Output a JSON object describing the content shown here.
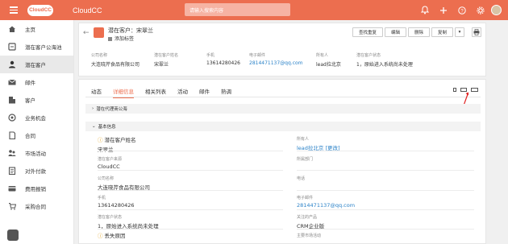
{
  "topbar": {
    "logo": "CloudCC",
    "app_name": "CloudCC",
    "search_placeholder": "请输入搜索内容",
    "icons": [
      "bell-icon",
      "plus-icon",
      "help-icon",
      "gear-icon"
    ]
  },
  "sidebar": {
    "items": [
      {
        "label": "主页",
        "icon": "home-icon"
      },
      {
        "label": "潜在客户公海池",
        "icon": "pool-icon"
      },
      {
        "label": "潜在客户",
        "icon": "person-icon",
        "active": true
      },
      {
        "label": "邮件",
        "icon": "mail-icon"
      },
      {
        "label": "客户",
        "icon": "building-icon"
      },
      {
        "label": "业务机会",
        "icon": "opportunity-icon"
      },
      {
        "label": "合同",
        "icon": "contract-icon"
      },
      {
        "label": "市场活动",
        "icon": "marketing-icon"
      },
      {
        "label": "对外付款",
        "icon": "payment-icon"
      },
      {
        "label": "费用报销",
        "icon": "expense-icon"
      },
      {
        "label": "采购合同",
        "icon": "purchase-icon"
      }
    ]
  },
  "header": {
    "title": "潜在客户：宋翠兰",
    "add_tag": "添加标签",
    "buttons": {
      "find_dup": "查找重复",
      "edit": "编辑",
      "delete": "删除",
      "copy": "复制",
      "more": "▾"
    },
    "fields": [
      {
        "label": "公司名称",
        "value": "大连晓芹食品有限公司",
        "link": false
      },
      {
        "label": "潜在客户姓名",
        "value": "宋翠兰",
        "link": false
      },
      {
        "label": "手机",
        "value": "13614280426",
        "link": false
      },
      {
        "label": "电子邮件",
        "value": "2814471137@qq.com",
        "link": true
      },
      {
        "label": "所有人",
        "value": "lead拉北京",
        "link": false
      },
      {
        "label": "潜在客户状态",
        "value": "1，原始进入系统尚未处理",
        "link": false
      }
    ]
  },
  "detail": {
    "tabs": [
      "动态",
      "详细信息",
      "相关列表",
      "活动",
      "邮件",
      "熟调"
    ],
    "active_tab": "详细信息",
    "section_collapsed": "潜在代理商公海",
    "section_basic": "基本信息",
    "fields_left": [
      {
        "label": "潜在客户姓名",
        "value": "宋翠兰",
        "required": true
      },
      {
        "label": "潜在客户来源",
        "value": "CloudCC",
        "required": false
      },
      {
        "label": "公司名称",
        "value": "大连晓芹食品有限公司",
        "required": false
      },
      {
        "label": "手机",
        "value": "13614280426",
        "required": false
      },
      {
        "label": "潜在客户状态",
        "value": "1，原始进入系统尚未处理",
        "required": false
      },
      {
        "label": "丢失原因",
        "value": "",
        "required": true
      }
    ],
    "fields_right": [
      {
        "label": "所有人",
        "value": "lead拉北京",
        "change": "[更改]"
      },
      {
        "label": "所属部门",
        "value": ""
      },
      {
        "label": "电话",
        "value": ""
      },
      {
        "label": "电子邮件",
        "value": "2814471137@qq.com",
        "link": true
      },
      {
        "label": "关注的产品",
        "value": "CRM企业版"
      },
      {
        "label": "主要市场活动",
        "value": ""
      }
    ]
  }
}
